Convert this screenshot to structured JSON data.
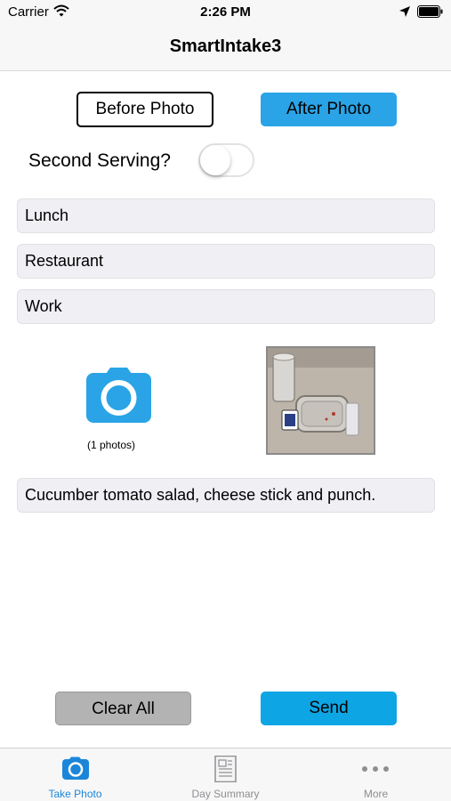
{
  "status_bar": {
    "carrier": "Carrier",
    "time": "2:26 PM"
  },
  "nav": {
    "title": "SmartIntake3"
  },
  "photo_mode": {
    "before_label": "Before Photo",
    "after_label": "After Photo",
    "selected": "After Photo"
  },
  "second_serving": {
    "label": "Second Serving?",
    "on": false
  },
  "fields": {
    "meal": "Lunch",
    "location": "Restaurant",
    "activity": "Work",
    "notes": "Cucumber tomato salad, cheese stick and punch."
  },
  "photos": {
    "count_label": "(1 photos)"
  },
  "actions": {
    "clear_label": "Clear All",
    "send_label": "Send"
  },
  "tabs": [
    {
      "label": "Take Photo",
      "icon": "camera-icon",
      "active": true
    },
    {
      "label": "Day Summary",
      "icon": "document-icon",
      "active": false
    },
    {
      "label": "More",
      "icon": "more-dots-icon",
      "active": false
    }
  ],
  "colors": {
    "accent": "#2aa4e6",
    "send": "#0ea5e4",
    "tab_active": "#1b86d9",
    "tab_inactive": "#8e8e93",
    "field_bg": "#efeff4"
  }
}
